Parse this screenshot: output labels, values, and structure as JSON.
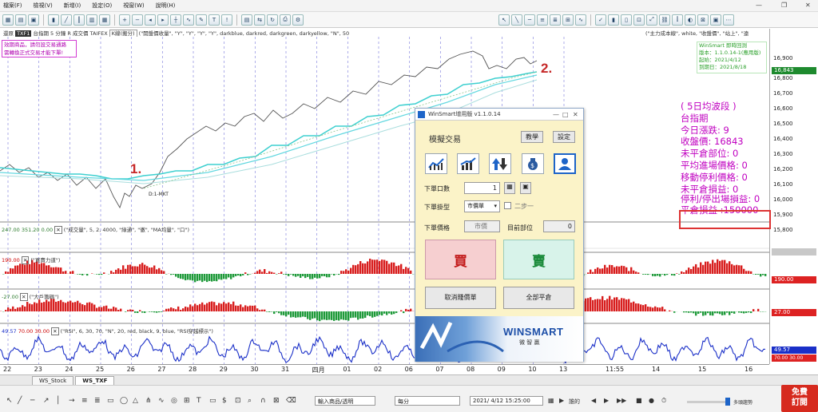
{
  "menu": {
    "items": [
      "檔案(F)",
      "檢視(V)",
      "新增(I)",
      "設定(O)",
      "視窗(W)",
      "說明(H)"
    ]
  },
  "window": {
    "minimize": "—",
    "restore": "❐",
    "close": "✕"
  },
  "infoline": {
    "left": "還原",
    "symbol": "TXF1",
    "chart": "台指期",
    "period": "5 分鐘",
    "field1": "R",
    "field2": "成交價",
    "code": "TAIFEX",
    "tooltip": "K線(搬分)",
    "formula": "(\"開盤價收量\", \"Y\", \"Y\", \"Y\", \"Y\", darkblue, darkred, darkgreen, darkyellow, \"N\", 50",
    "right": "(\"主力成本線\", white, \"收盤價\", \"站上\", \"遠"
  },
  "overlay_pink": {
    "line1": "效期商品，請勿設交易通路",
    "line2": "需轉換正式交易才能下單!"
  },
  "winsmart_info": {
    "title": "WinSmart 即時回測",
    "version": "版本：1.1.0.14-1(應用版)",
    "start": "起始：2021/4/12",
    "end": "到期日：2021/8/18"
  },
  "stats": {
    "title": "( 5日均波段 )",
    "product": "台指期",
    "change": "今日漲跌: 9",
    "close": "收盤價: 16843",
    "position": "未平倉部位: 0",
    "avg_entry": "平均進場價格: 0",
    "trail_stop": "移動停利價格: 0",
    "unrealized": "未平倉損益: 0",
    "stop_exit": "停利/停出場損益: 0",
    "realized": "平倉損益 :150000"
  },
  "annotations": {
    "one": "1.",
    "two": "2."
  },
  "chart_marker": "D:1-MKT",
  "price_axis": {
    "ticks": [
      "16,900",
      "16,800",
      "16,700",
      "16,600",
      "16,500",
      "16,400",
      "16,300",
      "16,200",
      "16,100",
      "16,000",
      "15,900",
      "15,800"
    ],
    "last_price": "16,843",
    "last_color": "#1e8a2e"
  },
  "indicators": [
    {
      "value": "247.00",
      "values2": "351.20  0.00",
      "formula": "(\"成交量\", 5, 2, 4000, \"綠通\", \"徹\", \"MA均量\", \"口\")",
      "tag": "",
      "tag_color": ""
    },
    {
      "value": "190.00",
      "values2": "",
      "formula": "(\"買賣力道\")",
      "tag": "190.00",
      "tag_color": "#d22"
    },
    {
      "value": "-27.00",
      "values2": "",
      "formula": "(\"大戶籌碼\")",
      "tag": "27.00",
      "tag_color": "#d22"
    },
    {
      "value": "49.57",
      "values2": "70.00  30.00",
      "formula": "(\"RSI\", 6, 30, 70, \"N\", 20, red, black, 9, blue, \"RSI穿越標示\")",
      "tag": "49.57",
      "tag_color": "#1a2fc8"
    }
  ],
  "date_axis": [
    "22",
    "23",
    "24",
    "25",
    "26",
    "27",
    "28",
    "29",
    "30",
    "31",
    "四月",
    "01",
    "02",
    "06",
    "07",
    "08",
    "09",
    "10",
    "13",
    "11:55",
    "14",
    "15",
    "16"
  ],
  "sheets": [
    "WS_Stock",
    "WS_TXF"
  ],
  "bottombar": {
    "symbol_select": "輸入商品/透明",
    "period_select": "每分",
    "datetime": "2021/ 4/12 15:25:00",
    "sync": "誰的",
    "hint": "多頭趨勢"
  },
  "free_button": {
    "line1": "免費",
    "line2": "訂閱"
  },
  "dialog": {
    "title": "WinSmart增用版 v1.1.0.14",
    "heading": "模擬交易",
    "teach": "教學",
    "settings": "設定",
    "qty_label": "下單口數",
    "qty_value": "1",
    "type_label": "下單掛型",
    "type_value": "市價單",
    "two_step": "二步一",
    "price_label": "下單價格",
    "price_value": "市價",
    "pos_label": "目前部位",
    "pos_value": "0",
    "buy": "買",
    "sell": "賣",
    "cancel_all": "取消賤價單",
    "close_all": "全部平倉",
    "brand": "WINSMART",
    "brand_sub": "微 智 贏"
  }
}
